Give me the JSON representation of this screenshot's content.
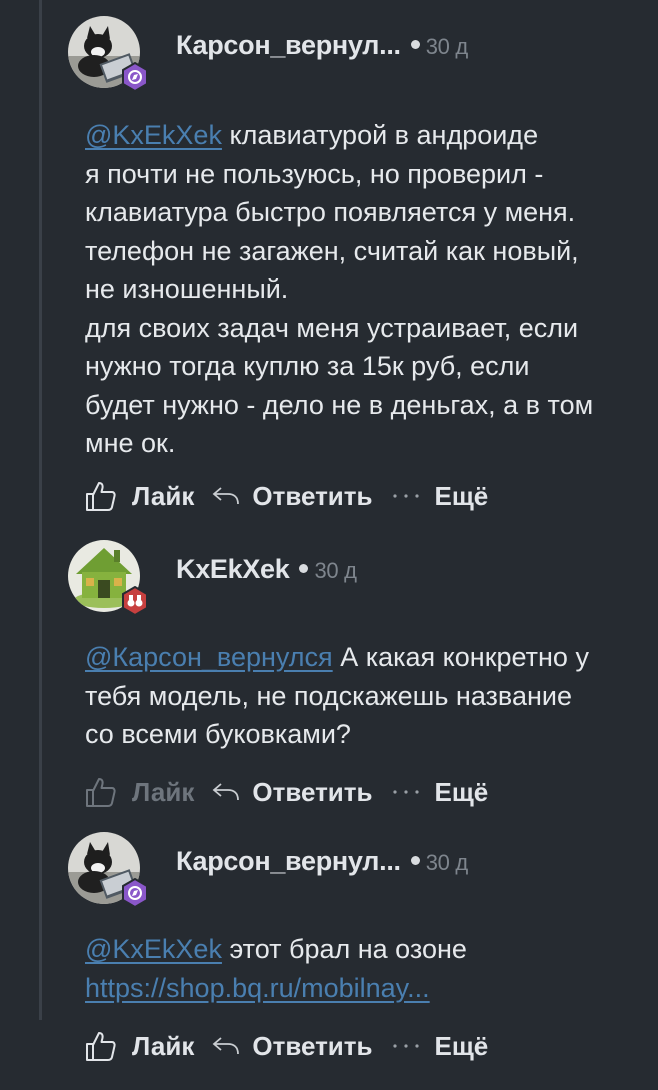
{
  "comments": [
    {
      "author": "Карсон_вернул...",
      "age": "30 д",
      "mention": "@KxEkXek",
      "text_after_mention": " клавиатурой в андроиде",
      "paragraph": "я почти не пользуюсь, но проверил -\nклавиатура быстро появляется у меня.\nтелефон не загажен, считай как новый,\nне изношенный.\nдля своих задач меня устраивает, если\nнужно тогда куплю за 15к руб, если\nбудет нужно - дело не в деньгах, а в том\nмне ок.",
      "like": "Лайк",
      "reply": "Ответить",
      "more": "Ещё",
      "avatar_icon": "cat-at-laptop-avatar",
      "badge_icon": "compass-badge-icon",
      "badge_color": "#8a57c9"
    },
    {
      "author": "KxEkXek",
      "age": "30 д",
      "mention": "@Карсон_вернулся",
      "text_after_mention": " А какая конкретно у",
      "paragraph": "тебя модель, не подскажешь название\nсо всеми буковками?",
      "like": "Лайк",
      "reply": "Ответить",
      "more": "Ещё",
      "avatar_icon": "mossy-house-avatar",
      "badge_icon": "binoculars-badge-icon",
      "badge_color": "#c7403f"
    },
    {
      "author": "Карсон_вернул...",
      "age": "30 д",
      "mention": "@KxEkXek",
      "text_after_mention": " этот брал на озоне",
      "link": "https://shop.bq.ru/mobilnay...",
      "like": "Лайк",
      "reply": "Ответить",
      "more": "Ещё",
      "avatar_icon": "cat-at-laptop-avatar",
      "badge_icon": "compass-badge-icon",
      "badge_color": "#8a57c9"
    }
  ],
  "colors": {
    "background": "#262b31",
    "mention": "#4a7fb0",
    "muted": "#7e858d"
  }
}
